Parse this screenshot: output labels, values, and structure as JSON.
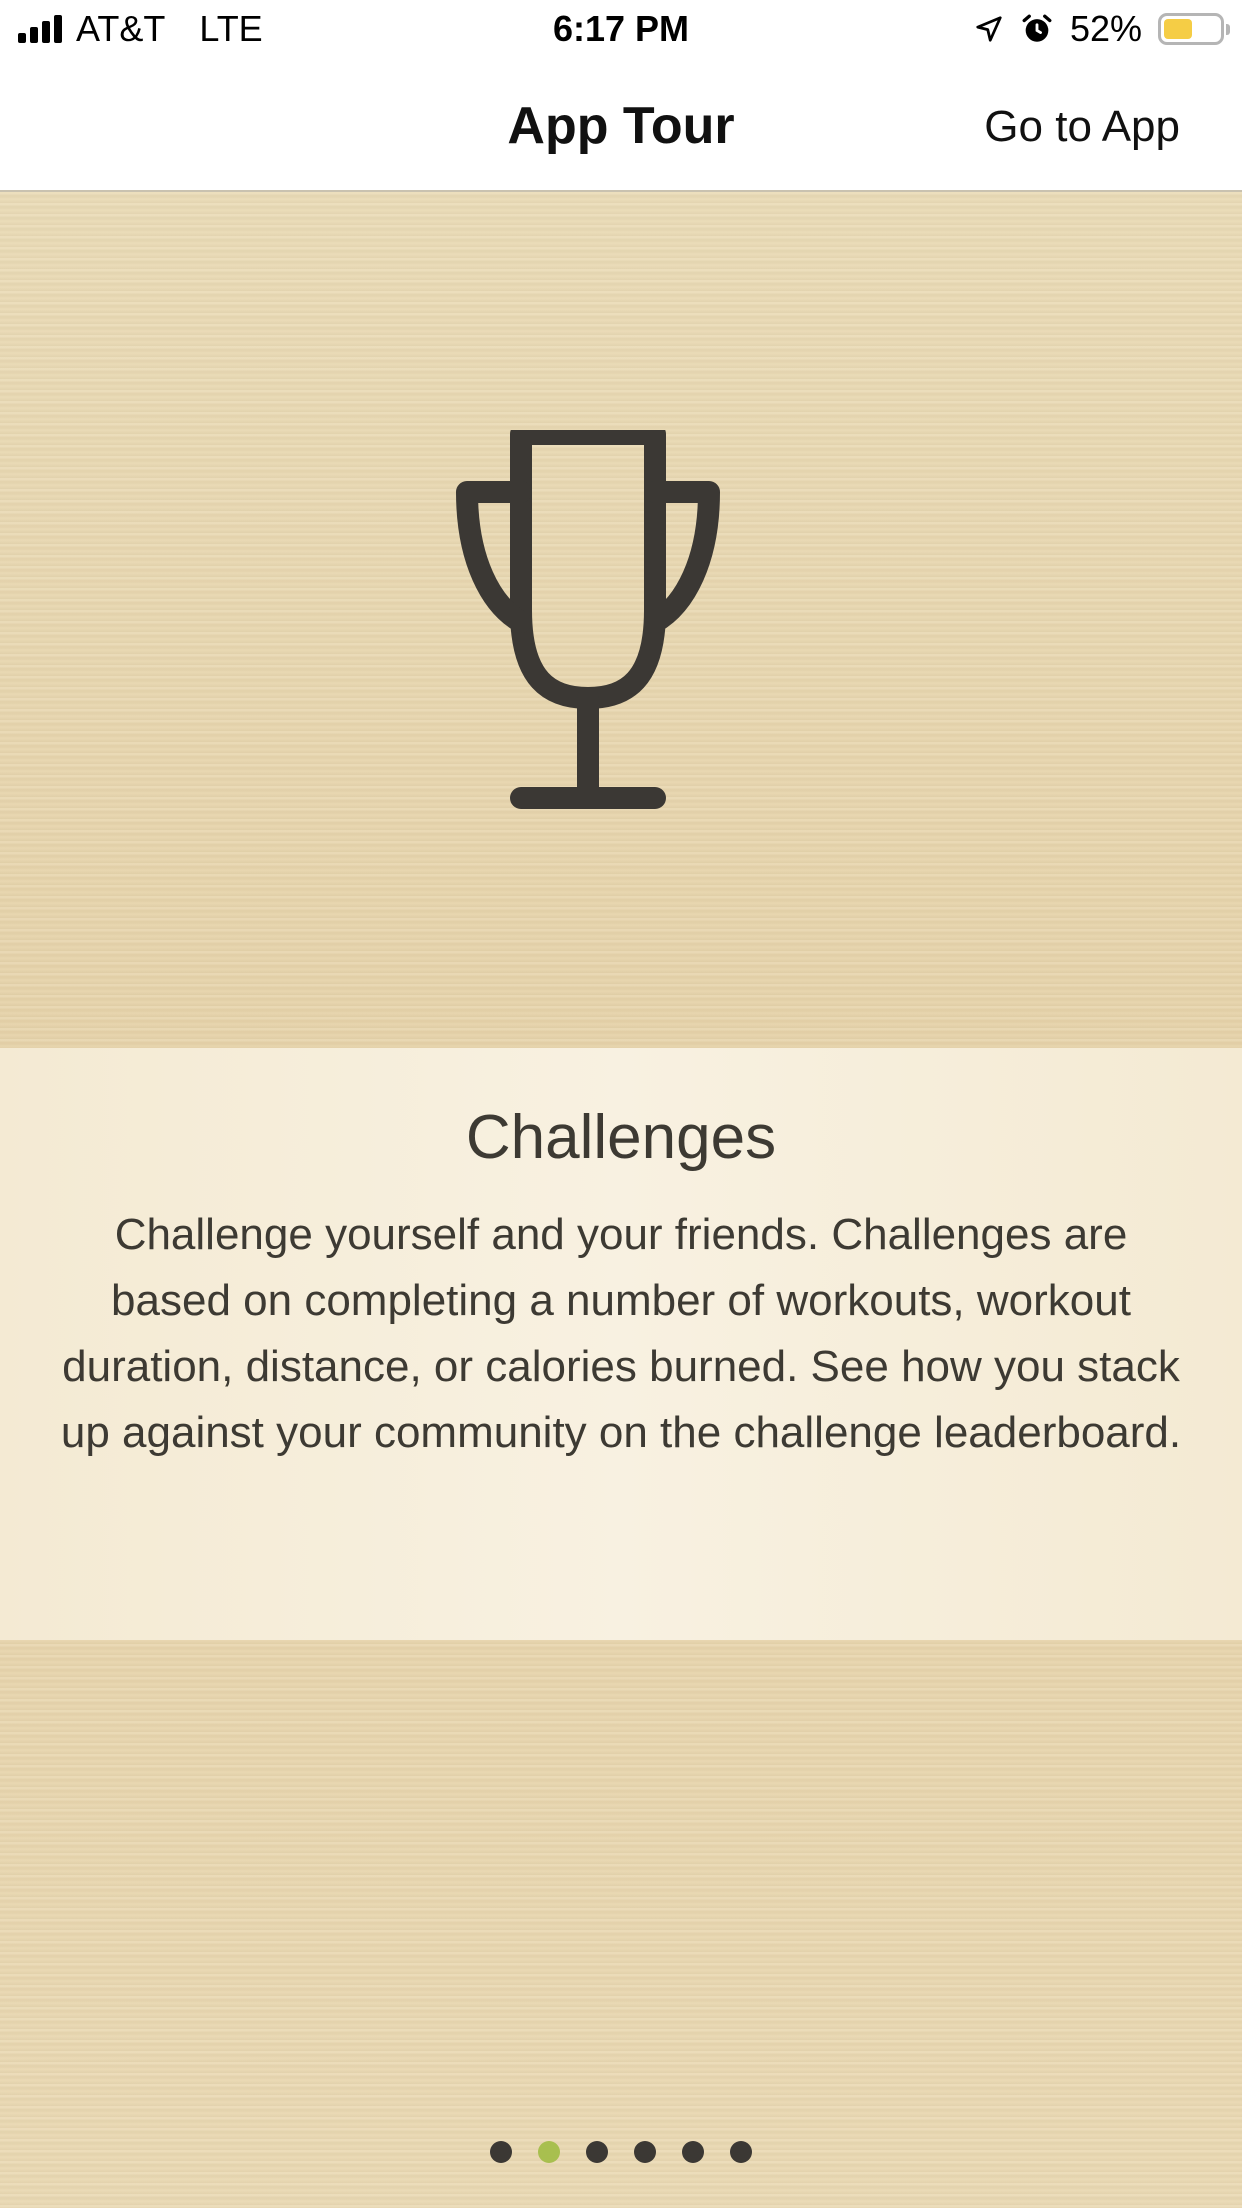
{
  "status_bar": {
    "carrier": "AT&T",
    "network": "LTE",
    "time": "6:17 PM",
    "battery_percent": "52%",
    "battery_level": 0.52,
    "icons": [
      "signal-icon",
      "location-arrow-icon",
      "alarm-clock-icon",
      "battery-icon"
    ]
  },
  "nav": {
    "title": "App Tour",
    "go_to_app": "Go to App"
  },
  "slide": {
    "icon": "trophy-icon",
    "title": "Challenges",
    "body": "Challenge yourself and your friends. Challenges are based on completing a number of workouts, workout duration, distance, or calories burned. See how you stack up against your community on the challenge leaderboard."
  },
  "pager": {
    "total": 6,
    "current": 2
  },
  "colors": {
    "wood_background": "#e8d7b0",
    "text": "#3d3a33",
    "active_dot": "#a8bf4f",
    "inactive_dot": "#3b3834",
    "battery": "#f5cd45"
  }
}
